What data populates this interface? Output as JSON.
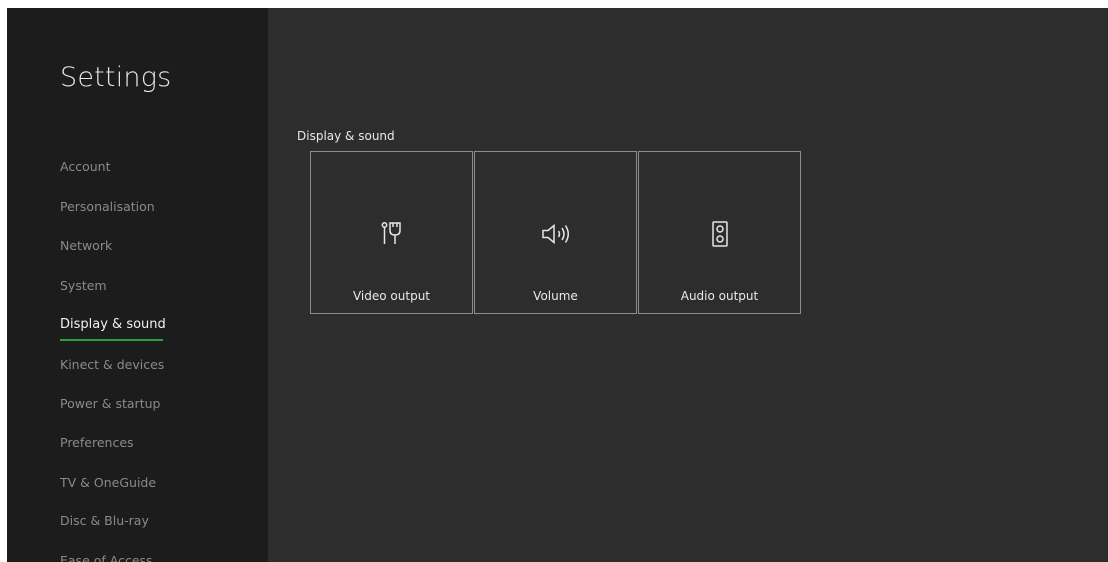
{
  "sidebar": {
    "title": "Settings",
    "items": [
      {
        "label": "Account"
      },
      {
        "label": "Personalisation"
      },
      {
        "label": "Network"
      },
      {
        "label": "System"
      },
      {
        "label": "Display & sound",
        "selected": true
      },
      {
        "label": "Kinect & devices"
      },
      {
        "label": "Power & startup"
      },
      {
        "label": "Preferences"
      },
      {
        "label": "TV & OneGuide"
      },
      {
        "label": "Disc & Blu-ray"
      },
      {
        "label": "Ease of Access"
      }
    ]
  },
  "main": {
    "heading": "Display & sound",
    "tiles": [
      {
        "label": "Video output",
        "icon": "video-cable-icon"
      },
      {
        "label": "Volume",
        "icon": "speaker-volume-icon"
      },
      {
        "label": "Audio output",
        "icon": "audio-speaker-icon"
      }
    ]
  },
  "colors": {
    "sidebar_bg": "#1c1c1c",
    "content_bg": "#2d2d2d",
    "accent": "#2f9e3c"
  }
}
